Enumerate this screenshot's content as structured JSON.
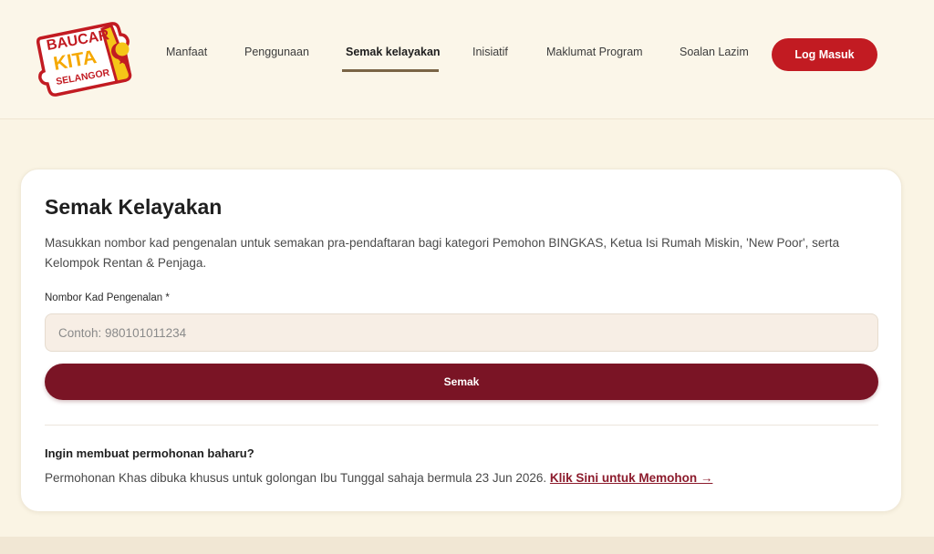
{
  "brand": {
    "logo_line1": "BAUCAR",
    "logo_line2": "KITA",
    "logo_line3": "SELANGOR",
    "colors": {
      "primary_red": "#c21b22",
      "maroon": "#7a1425",
      "yellow": "#f5c518"
    }
  },
  "nav": {
    "items": [
      {
        "label": "Manfaat"
      },
      {
        "label": "Penggunaan"
      },
      {
        "label": "Semak kelayakan",
        "active": true
      },
      {
        "label": "Inisiatif"
      },
      {
        "label": "Maklumat Program"
      },
      {
        "label": "Soalan Lazim"
      }
    ],
    "login_label": "Log Masuk"
  },
  "card": {
    "title": "Semak Kelayakan",
    "description": "Masukkan nombor kad pengenalan untuk semakan pra-pendaftaran bagi kategori Pemohon BINGKAS, Ketua Isi Rumah Miskin, 'New Poor', serta Kelompok Rentan & Penjaga.",
    "field_label": "Nombor Kad Pengenalan *",
    "field_value": "",
    "field_placeholder": "Contoh: 980101011234",
    "submit_label": "Semak",
    "new_app_title": "Ingin membuat permohonan baharu?",
    "new_app_text": "Permohonan Khas dibuka khusus untuk golongan Ibu Tunggal sahaja bermula 23 Jun 2026. ",
    "new_app_link": "Klik Sini untuk Memohon →"
  }
}
